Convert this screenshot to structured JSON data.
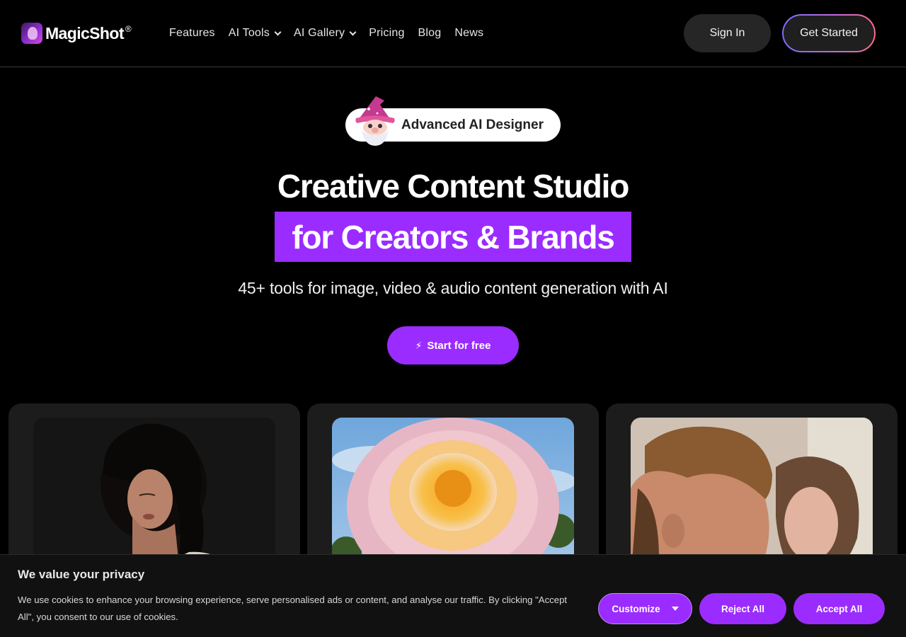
{
  "nav": {
    "brand": "MagicShot",
    "brand_mark": "®",
    "links": [
      {
        "label": "Features"
      },
      {
        "label": "AI Tools"
      },
      {
        "label": "AI Gallery"
      },
      {
        "label": "Pricing"
      },
      {
        "label": "Blog"
      },
      {
        "label": "News"
      }
    ],
    "sign_in": "Sign In",
    "get_started": "Get Started"
  },
  "hero": {
    "badge": "Advanced AI Designer",
    "title_line1": "Creative Content Studio",
    "title_line2": "for Creators & Brands",
    "subtitle": "45+ tools for image, video & audio content generation with AI",
    "cta": "Start for free",
    "cta_icon": "⚡"
  },
  "gallery": {
    "cards": [
      {
        "image": "portrait-woman-curly-hair"
      },
      {
        "image": "giant-orange-pink-flower"
      },
      {
        "image": "couple-kissing"
      }
    ]
  },
  "cookie": {
    "title": "We value your privacy",
    "text": "We use cookies to enhance your browsing experience, serve personalised ads or content, and analyse our traffic. By clicking \"Accept All\", you consent to our use of cookies.",
    "customize": "Customize",
    "reject": "Reject All",
    "accept": "Accept All"
  },
  "colors": {
    "accent": "#9b2cff",
    "background": "#000000",
    "card": "#1c1c1c"
  }
}
